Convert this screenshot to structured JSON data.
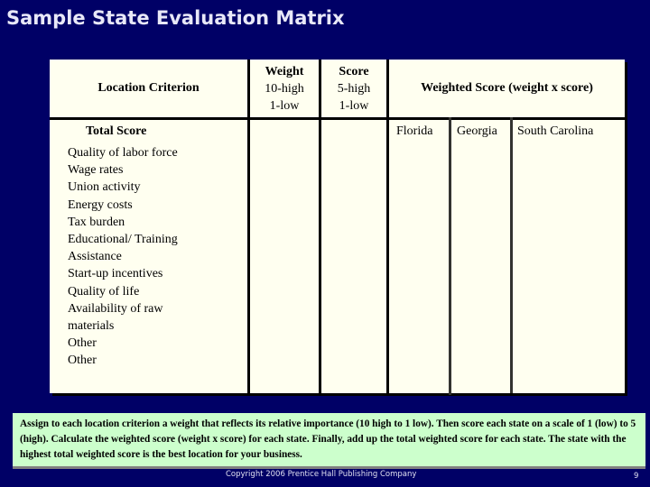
{
  "slide": {
    "title": "Sample State Evaluation Matrix",
    "colors": {
      "background": "#000066",
      "table_fill": "#fffff0",
      "instructions_fill": "#ccffcc",
      "title_text": "#e8e8f8"
    }
  },
  "matrix": {
    "headers": {
      "location_criterion": "Location Criterion",
      "weight": {
        "label": "Weight",
        "high": "10-high",
        "low": "1-low"
      },
      "score": {
        "label": "Score",
        "high": "5-high",
        "low": "1-low"
      },
      "weighted_score": "Weighted Score (weight x score)"
    },
    "total_score_label": "Total Score",
    "states": [
      "Florida",
      "Georgia",
      "South Carolina"
    ],
    "criteria": [
      "Quality of labor force",
      "Wage rates",
      "Union activity",
      "Energy costs",
      "Tax burden",
      "Educational/ Training",
      "Assistance",
      "Start-up incentives",
      "Quality of life",
      "Availability of raw",
      "materials",
      "Other",
      "Other"
    ]
  },
  "instructions": {
    "text": "Assign to each location criterion a weight that reflects its relative importance (10 high to 1 low).  Then score each state on a scale of 1 (low) to 5 (high).  Calculate the weighted score (weight x score) for each state.  Finally, add up the total weighted score for each state.  The state with the highest total weighted score is the best location for your business."
  },
  "footer": {
    "copyright": "Copyright 2006 Prentice Hall Publishing Company",
    "page_number": "9"
  }
}
